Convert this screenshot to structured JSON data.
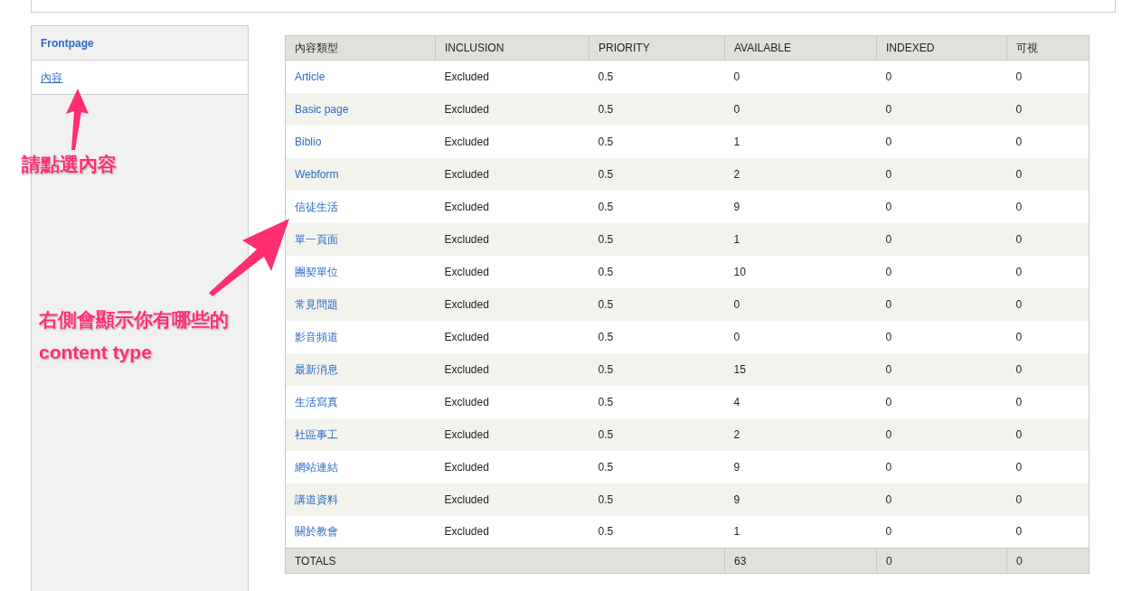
{
  "sidebar": {
    "tabs": [
      {
        "label": "Frontpage",
        "selected": false
      },
      {
        "label": "內容",
        "selected": true
      }
    ]
  },
  "table": {
    "columns": [
      "內容類型",
      "INCLUSION",
      "PRIORITY",
      "AVAILABLE",
      "INDEXED",
      "可視"
    ],
    "rows": [
      [
        "Article",
        "Excluded",
        "0.5",
        "0",
        "0",
        "0"
      ],
      [
        "Basic page",
        "Excluded",
        "0.5",
        "0",
        "0",
        "0"
      ],
      [
        "Biblio",
        "Excluded",
        "0.5",
        "1",
        "0",
        "0"
      ],
      [
        "Webform",
        "Excluded",
        "0.5",
        "2",
        "0",
        "0"
      ],
      [
        "信徒生活",
        "Excluded",
        "0.5",
        "9",
        "0",
        "0"
      ],
      [
        "單一頁面",
        "Excluded",
        "0.5",
        "1",
        "0",
        "0"
      ],
      [
        "團契單位",
        "Excluded",
        "0.5",
        "10",
        "0",
        "0"
      ],
      [
        "常見問題",
        "Excluded",
        "0.5",
        "0",
        "0",
        "0"
      ],
      [
        "影音頻道",
        "Excluded",
        "0.5",
        "0",
        "0",
        "0"
      ],
      [
        "最新消息",
        "Excluded",
        "0.5",
        "15",
        "0",
        "0"
      ],
      [
        "生活寫真",
        "Excluded",
        "0.5",
        "4",
        "0",
        "0"
      ],
      [
        "社區事工",
        "Excluded",
        "0.5",
        "2",
        "0",
        "0"
      ],
      [
        "網站連結",
        "Excluded",
        "0.5",
        "9",
        "0",
        "0"
      ],
      [
        "講道資料",
        "Excluded",
        "0.5",
        "9",
        "0",
        "0"
      ],
      [
        "關於教會",
        "Excluded",
        "0.5",
        "1",
        "0",
        "0"
      ]
    ],
    "totals": {
      "label": "TOTALS",
      "available": "63",
      "indexed": "0",
      "visible": "0"
    }
  },
  "annotations": [
    {
      "kind": "up",
      "lines": [
        "請點選內容"
      ]
    },
    {
      "kind": "diagonal",
      "lines": [
        "右側會顯示你有哪些的",
        "content type"
      ]
    }
  ]
}
